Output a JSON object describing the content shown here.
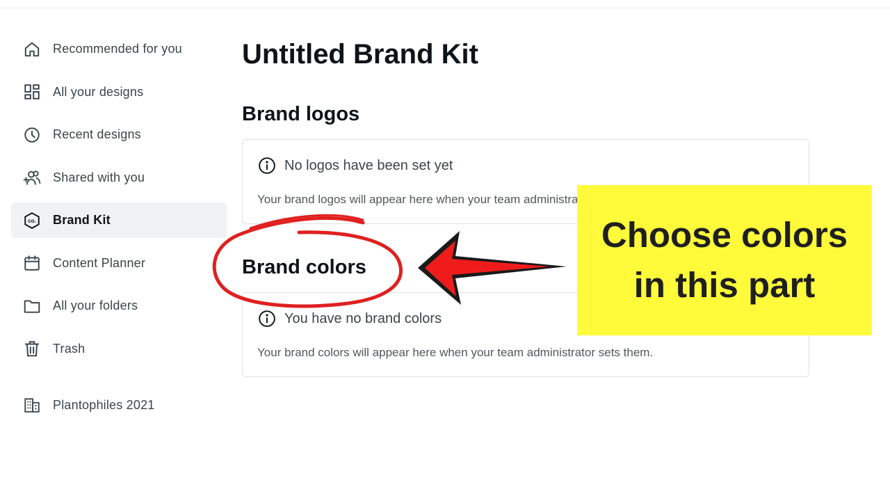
{
  "sidebar": {
    "items": [
      {
        "label": "Recommended for you",
        "icon": "home-icon"
      },
      {
        "label": "All your designs",
        "icon": "grid-icon"
      },
      {
        "label": "Recent designs",
        "icon": "clock-icon"
      },
      {
        "label": "Shared with you",
        "icon": "shared-users-icon"
      },
      {
        "label": "Brand Kit",
        "icon": "brand-kit-icon",
        "active": true
      },
      {
        "label": "Content Planner",
        "icon": "calendar-icon"
      },
      {
        "label": "All your folders",
        "icon": "folder-icon"
      },
      {
        "label": "Trash",
        "icon": "trash-icon"
      }
    ],
    "team": {
      "label": "Plantophiles 2021",
      "icon": "building-icon"
    },
    "brand_kit_icon_text": "co."
  },
  "main": {
    "title": "Untitled Brand Kit",
    "logos": {
      "heading": "Brand logos",
      "empty_title": "No logos have been set yet",
      "empty_desc": "Your brand logos will appear here when your team administrator sets them."
    },
    "colors": {
      "heading": "Brand colors",
      "empty_title": "You have no brand colors",
      "empty_desc": "Your brand colors will appear here when your team administrator sets them."
    }
  },
  "annotation": {
    "callout_line1": "Choose colors",
    "callout_line2": "in this part",
    "callout_bg": "#fffb3a",
    "arrow_color": "#f01c1c",
    "circle_color": "#e02020"
  }
}
